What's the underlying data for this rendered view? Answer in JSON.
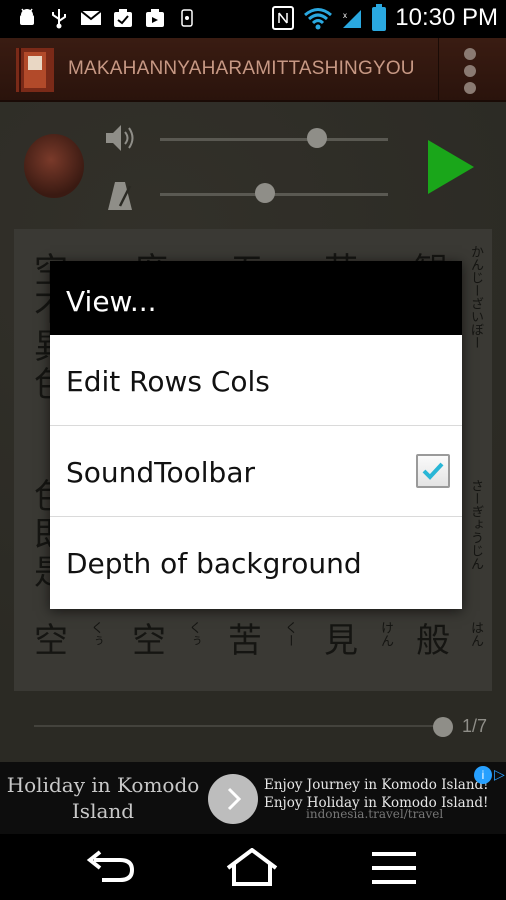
{
  "status_bar": {
    "time": "10:30 PM",
    "icons": [
      "android-debug-icon",
      "usb-icon",
      "gmail-icon",
      "task-icon",
      "download-icon",
      "storage-icon",
      "nfc-icon",
      "wifi-icon",
      "signal-icon",
      "battery-icon"
    ]
  },
  "app_bar": {
    "title": "MAKAHANNYAHARAMITTASHINGYOU",
    "icon": "sutra-book-icon",
    "menu_icon": "overflow-menu-icon"
  },
  "controls": {
    "volume_level": 0.69,
    "tempo_level": 0.46,
    "play_icon": "play-icon",
    "play_color": "#1aa61a"
  },
  "sutra": {
    "bottom_row": [
      {
        "kanji": "空",
        "furi": "くぅ"
      },
      {
        "kanji": "空",
        "furi": "くぅ"
      },
      {
        "kanji": "苦",
        "furi": "くー"
      },
      {
        "kanji": "見",
        "furi": "けん"
      },
      {
        "kanji": "般",
        "furi": "はん"
      }
    ],
    "right_col_top_furi": "かんじーざいぼー",
    "right_col_mid_furi": "さーぎょうじん"
  },
  "pager": {
    "page_indicator": "1/7",
    "position": 1.0
  },
  "dialog": {
    "title": "View...",
    "items": [
      {
        "label": "Edit Rows Cols",
        "has_checkbox": false
      },
      {
        "label": "SoundToolbar",
        "has_checkbox": true,
        "checked": true
      },
      {
        "label": "Depth of background",
        "has_checkbox": false
      }
    ],
    "check_color": "#29b6d6"
  },
  "ad": {
    "headline_line1": "Holiday in Komodo",
    "headline_line2": "Island",
    "text_line1": "Enjoy Journey in Komodo Island!",
    "text_line2": "Enjoy Holiday in Komodo Island!",
    "url": "indonesia.travel/travel"
  },
  "nav_bar": {
    "back_icon": "back-icon",
    "home_icon": "home-icon",
    "menu_icon": "menu-icon"
  }
}
